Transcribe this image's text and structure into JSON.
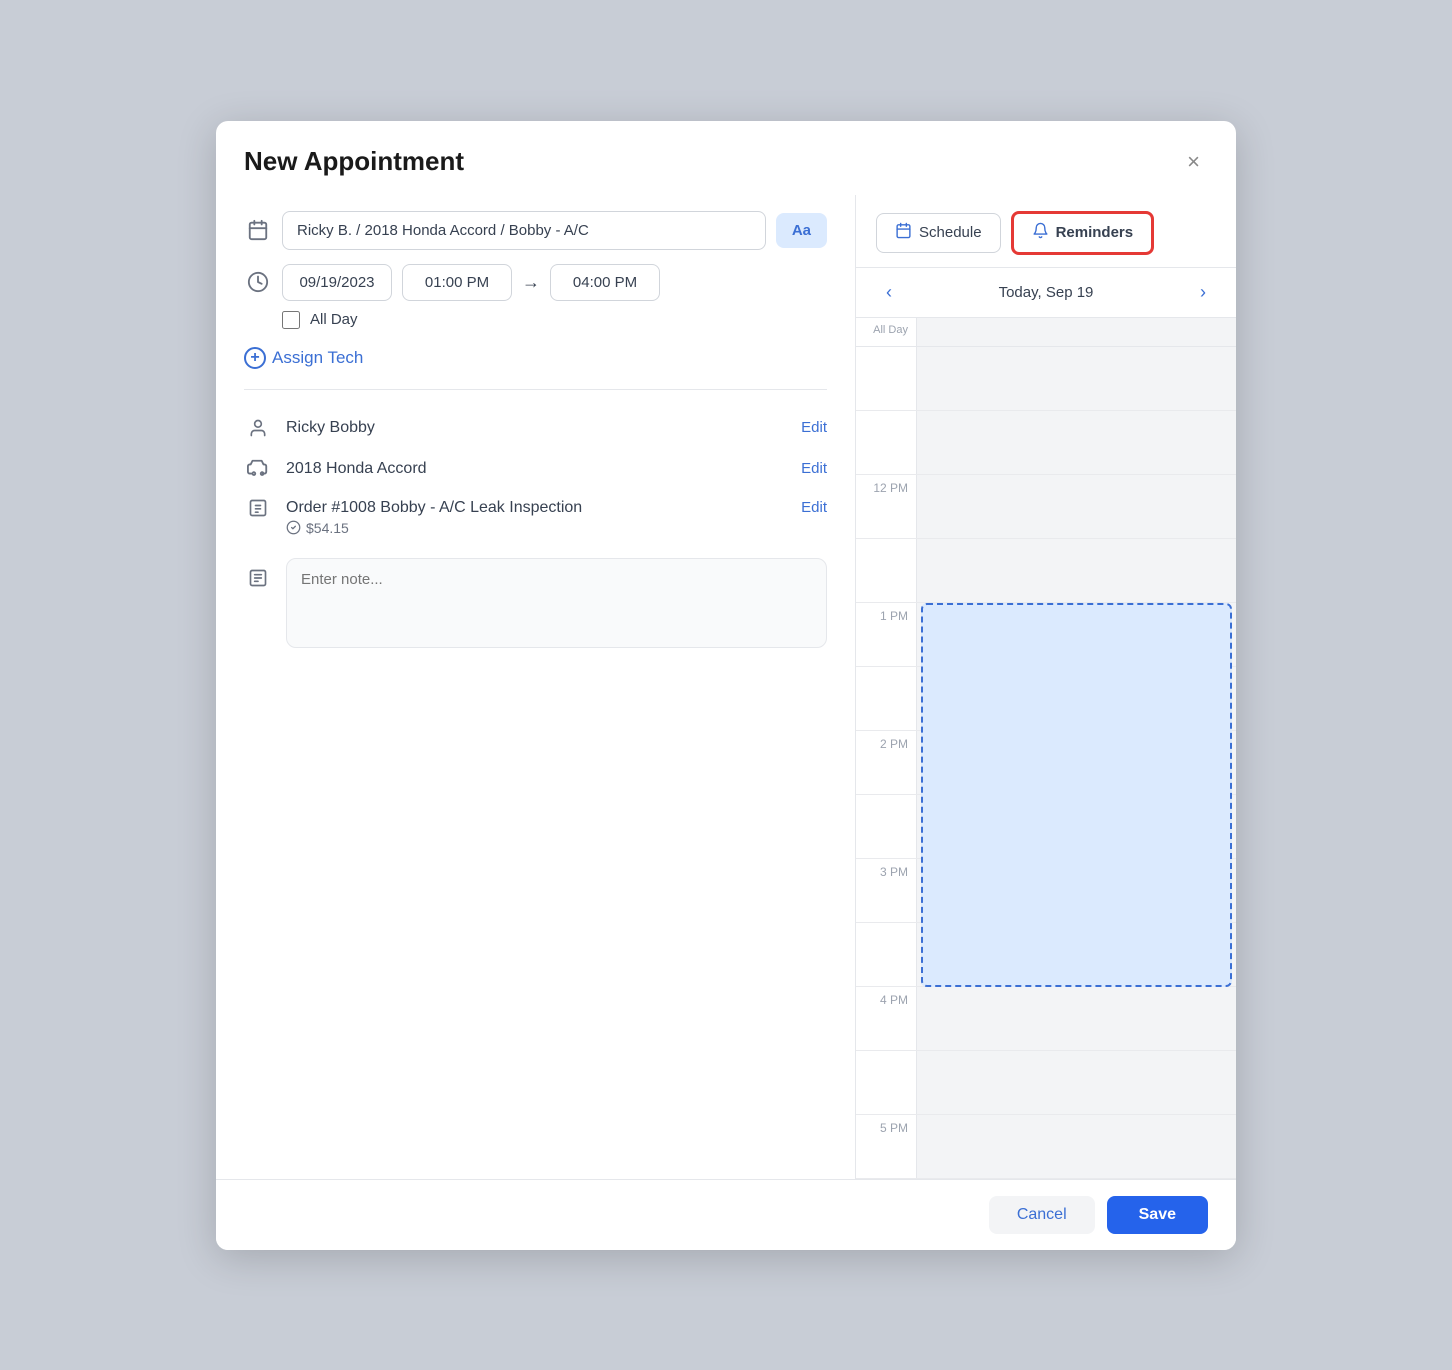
{
  "modal": {
    "title": "New Appointment",
    "close_label": "×"
  },
  "left": {
    "appointment_value": "Ricky B. / 2018 Honda Accord / Bobby - A/C",
    "aa_label": "Aa",
    "date_value": "09/19/2023",
    "time_start": "01:00 PM",
    "time_end": "04:00 PM",
    "arrow": "→",
    "allday_label": "All Day",
    "assign_tech_label": "Assign Tech",
    "customer_name": "Ricky Bobby",
    "customer_edit": "Edit",
    "vehicle_name": "2018 Honda Accord",
    "vehicle_edit": "Edit",
    "order_label": "Order #1008 Bobby - A/C Leak Inspection",
    "order_edit": "Edit",
    "order_price": "$54.15",
    "note_placeholder": "Enter note..."
  },
  "right": {
    "schedule_tab": "Schedule",
    "reminders_tab": "Reminders",
    "date_nav_label": "Today, Sep 19",
    "prev_arrow": "‹",
    "next_arrow": "›",
    "allday_label": "All Day",
    "time_slots": [
      {
        "label": "",
        "hour": ""
      },
      {
        "label": "",
        "hour": ""
      },
      {
        "label": "12 PM",
        "hour": "12pm"
      },
      {
        "label": "",
        "hour": ""
      },
      {
        "label": "1 PM",
        "hour": "1pm"
      },
      {
        "label": "",
        "hour": ""
      },
      {
        "label": "2 PM",
        "hour": "2pm"
      },
      {
        "label": "",
        "hour": ""
      },
      {
        "label": "3 PM",
        "hour": "3pm"
      },
      {
        "label": "",
        "hour": ""
      },
      {
        "label": "4 PM",
        "hour": "4pm"
      },
      {
        "label": "",
        "hour": ""
      },
      {
        "label": "5 PM",
        "hour": "5pm"
      }
    ],
    "appointment_block": {
      "top_slot_index": 4,
      "span_slots": 6,
      "label": ""
    }
  },
  "footer": {
    "cancel_label": "Cancel",
    "save_label": "Save"
  },
  "icons": {
    "calendar": "📅",
    "clock": "🕐",
    "person": "👤",
    "car": "🚗",
    "order": "📋",
    "note": "📄",
    "bell": "🔔",
    "schedule_cal": "📅"
  }
}
